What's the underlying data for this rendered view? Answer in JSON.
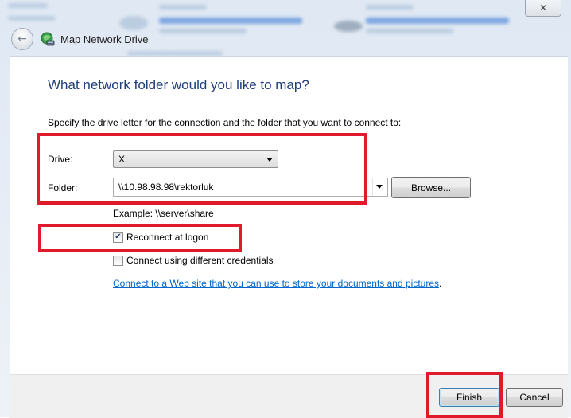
{
  "window": {
    "title": "Map Network Drive",
    "close_glyph": "✕"
  },
  "icons": {
    "back": "back-arrow-icon",
    "network": "network-drive-icon",
    "close": "close-icon",
    "dropdown": "chevron-down-icon",
    "check": "checkmark-icon"
  },
  "main": {
    "heading": "What network folder would you like to map?",
    "instruction": "Specify the drive letter for the connection and the folder that you want to connect to:",
    "drive": {
      "label": "Drive:",
      "value": "X:"
    },
    "folder": {
      "label": "Folder:",
      "value": "\\\\10.98.98.98\\rektorluk"
    },
    "browse_label": "Browse...",
    "example": "Example: \\\\server\\share",
    "reconnect": {
      "label": "Reconnect at logon",
      "checked": true
    },
    "different_credentials": {
      "label": "Connect using different credentials",
      "checked": false
    },
    "link": "Connect to a Web site that you can use to store your documents and pictures",
    "link_suffix": "."
  },
  "footer": {
    "finish_label": "Finish",
    "cancel_label": "Cancel"
  },
  "colors": {
    "heading": "#1f3d7a",
    "link": "#0066cc",
    "highlight": "#e01a2b"
  }
}
